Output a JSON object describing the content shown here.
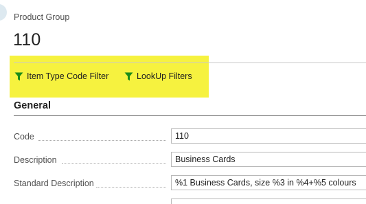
{
  "page": {
    "caption": "Product Group",
    "record_title": "110"
  },
  "actions": [
    {
      "label": "Item Type Code Filter",
      "icon": "filter-icon"
    },
    {
      "label": "LookUp Filters",
      "icon": "filter-icon"
    }
  ],
  "colors": {
    "highlight": "#f6f23f",
    "filter_icon": "#1a8c1a"
  },
  "general": {
    "title": "General",
    "fields": [
      {
        "label": "Code",
        "value": "110"
      },
      {
        "label": "Description",
        "value": "Business Cards"
      },
      {
        "label": "Standard Description",
        "value": "%1 Business Cards, size %3  in %4+%5 colours"
      }
    ]
  }
}
